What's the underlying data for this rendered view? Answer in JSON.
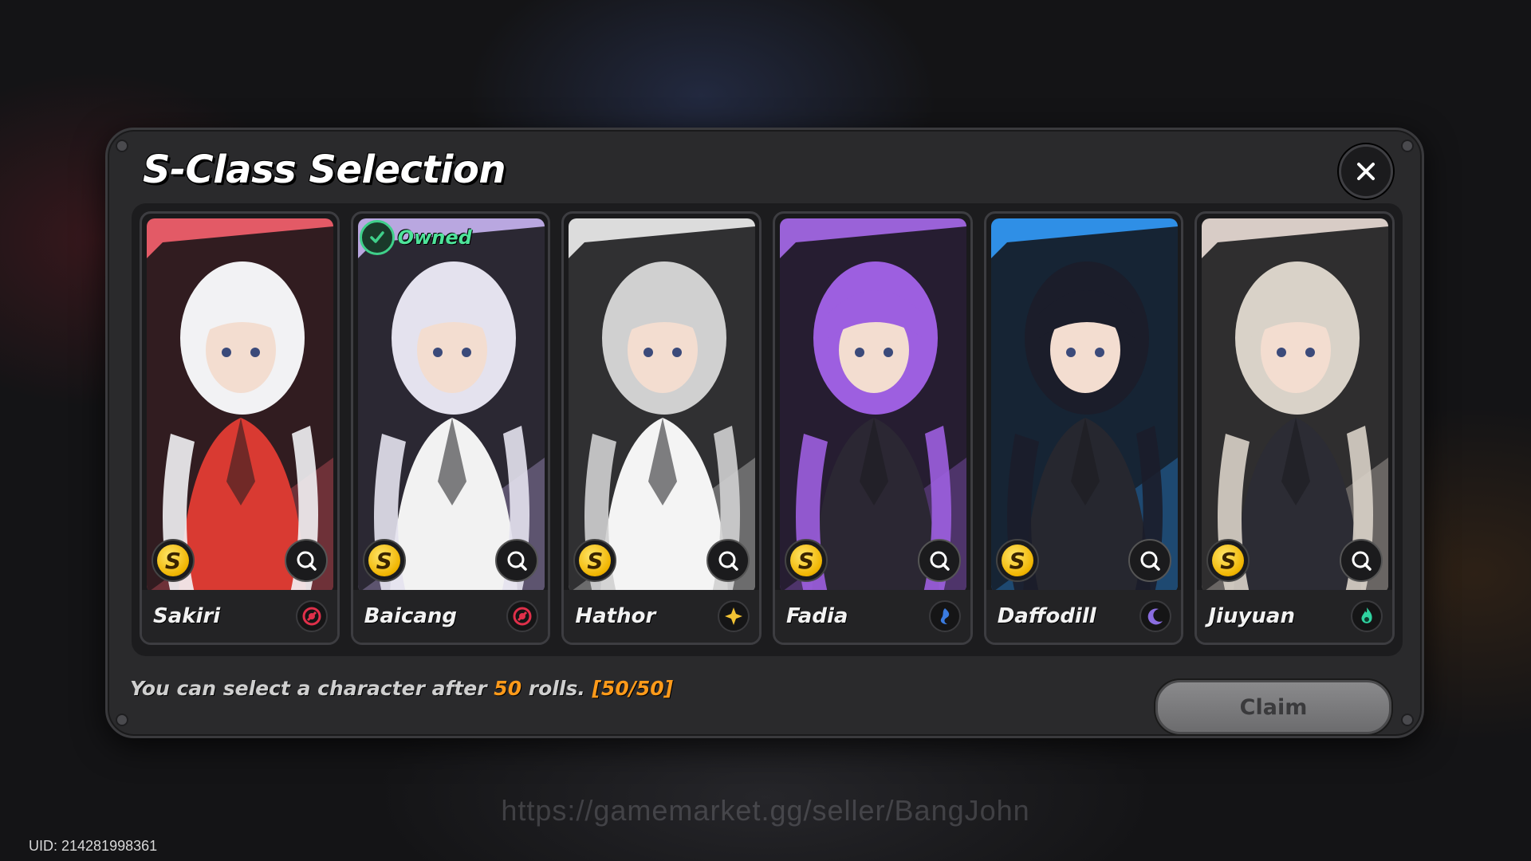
{
  "modal": {
    "title": "S-Class Selection",
    "close_icon": "close-icon"
  },
  "characters": [
    {
      "name": "Sakiri",
      "rank": "S",
      "owned": false,
      "element": "crimson-ring",
      "element_color": "#e0304a",
      "bg": "#e35a66",
      "hair": "#f2f2f4",
      "outfit": "#d93a32"
    },
    {
      "name": "Baicang",
      "rank": "S",
      "owned": true,
      "owned_label": "Owned",
      "element": "crimson-ring",
      "element_color": "#e0304a",
      "bg": "#b9a7e0",
      "hair": "#e4e2ee",
      "outfit": "#f2f2f2"
    },
    {
      "name": "Hathor",
      "rank": "S",
      "owned": false,
      "element": "gold-star",
      "element_color": "#f2c233",
      "bg": "#dcdcdc",
      "hair": "#d0d0d0",
      "outfit": "#f4f4f4"
    },
    {
      "name": "Fadia",
      "rank": "S",
      "owned": false,
      "element": "blue-wave",
      "element_color": "#3a7be0",
      "bg": "#9a62d8",
      "hair": "#9d5fe0",
      "outfit": "#2b2733"
    },
    {
      "name": "Daffodill",
      "rank": "S",
      "owned": false,
      "element": "violet-moon",
      "element_color": "#8a6de0",
      "bg": "#2f8fe6",
      "hair": "#1b1d2a",
      "outfit": "#26272f"
    },
    {
      "name": "Jiuyuan",
      "rank": "S",
      "owned": false,
      "element": "teal-flame",
      "element_color": "#2fd3a0",
      "bg": "#d8ccc6",
      "hair": "#d9d2c8",
      "outfit": "#2c2c34"
    }
  ],
  "footer": {
    "prefix": "You can select a character after ",
    "count": "50",
    "suffix": " rolls. ",
    "progress": "[50/50]"
  },
  "claim_label": "Claim",
  "watermark": "https://gamemarket.gg/seller/BangJohn",
  "uid": "UID: 214281998361"
}
